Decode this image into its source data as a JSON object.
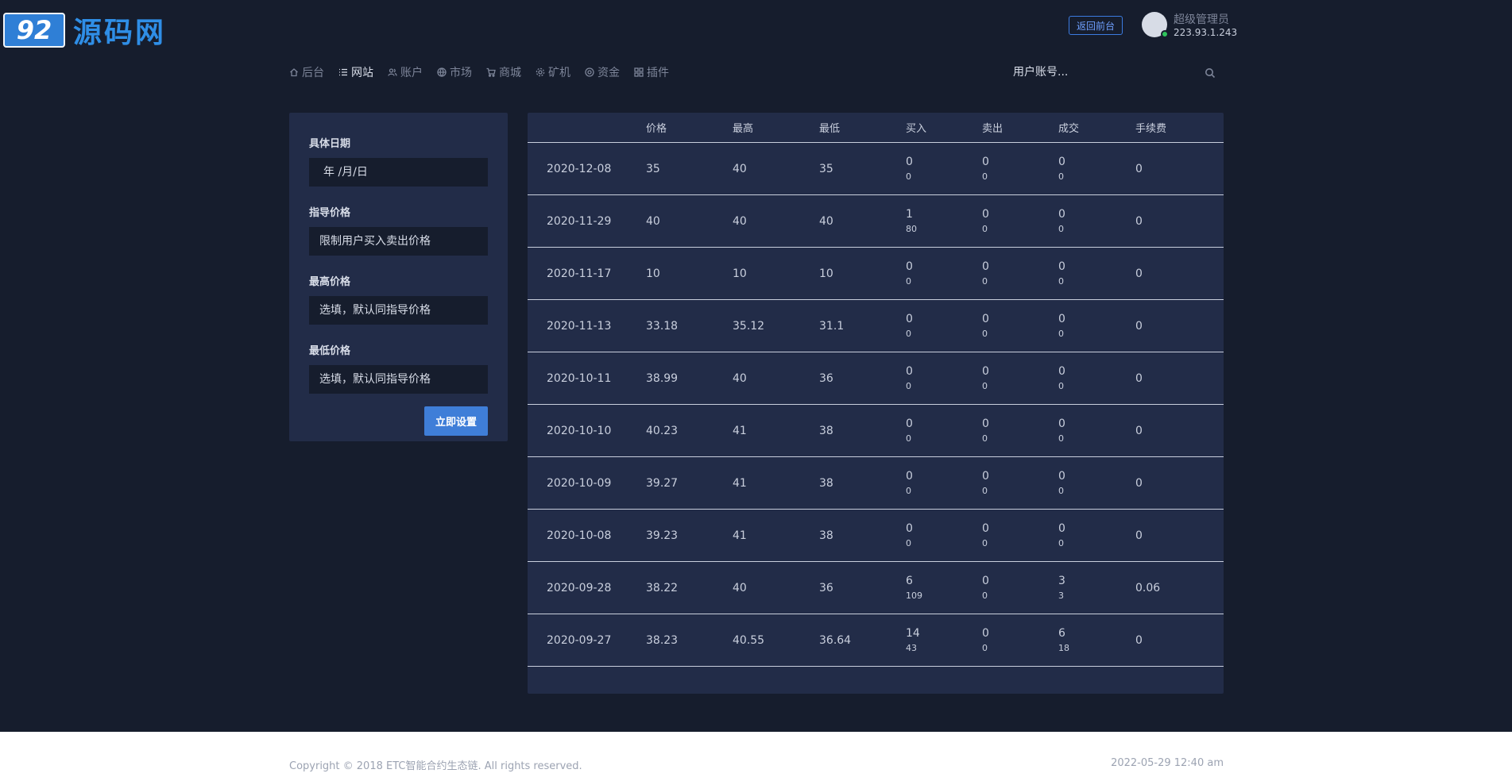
{
  "logo": {
    "mark": "92",
    "text": "源码网"
  },
  "header": {
    "front_button": "返回前台",
    "user_name": "超级管理员",
    "user_ip": "223.93.1.243"
  },
  "nav": {
    "items": [
      {
        "label": "后台",
        "icon": "home-icon"
      },
      {
        "label": "网站",
        "icon": "list-icon"
      },
      {
        "label": "账户",
        "icon": "users-icon"
      },
      {
        "label": "市场",
        "icon": "globe-icon"
      },
      {
        "label": "商城",
        "icon": "cart-icon"
      },
      {
        "label": "矿机",
        "icon": "gear-icon"
      },
      {
        "label": "资金",
        "icon": "coin-icon"
      },
      {
        "label": "插件",
        "icon": "grid-icon"
      }
    ],
    "active": "网站"
  },
  "search": {
    "placeholder": "用户账号..."
  },
  "form": {
    "date_label": "具体日期",
    "date_placeholder": "年 /月/日",
    "guide_label": "指导价格",
    "guide_placeholder": "限制用户买入卖出价格",
    "high_label": "最高价格",
    "high_placeholder": "选填，默认同指导价格",
    "low_label": "最低价格",
    "low_placeholder": "选填，默认同指导价格",
    "submit": "立即设置"
  },
  "table": {
    "headers": [
      "",
      "价格",
      "最高",
      "最低",
      "买入",
      "卖出",
      "成交",
      "手续费"
    ],
    "rows": [
      {
        "date": "2020-12-08",
        "price": "35",
        "high": "40",
        "low": "35",
        "buy": "0",
        "buy_sub": "0",
        "sell": "0",
        "sell_sub": "0",
        "deal": "0",
        "deal_sub": "0",
        "fee": "0"
      },
      {
        "date": "2020-11-29",
        "price": "40",
        "high": "40",
        "low": "40",
        "buy": "1",
        "buy_sub": "80",
        "sell": "0",
        "sell_sub": "0",
        "deal": "0",
        "deal_sub": "0",
        "fee": "0"
      },
      {
        "date": "2020-11-17",
        "price": "10",
        "high": "10",
        "low": "10",
        "buy": "0",
        "buy_sub": "0",
        "sell": "0",
        "sell_sub": "0",
        "deal": "0",
        "deal_sub": "0",
        "fee": "0"
      },
      {
        "date": "2020-11-13",
        "price": "33.18",
        "high": "35.12",
        "low": "31.1",
        "buy": "0",
        "buy_sub": "0",
        "sell": "0",
        "sell_sub": "0",
        "deal": "0",
        "deal_sub": "0",
        "fee": "0"
      },
      {
        "date": "2020-10-11",
        "price": "38.99",
        "high": "40",
        "low": "36",
        "buy": "0",
        "buy_sub": "0",
        "sell": "0",
        "sell_sub": "0",
        "deal": "0",
        "deal_sub": "0",
        "fee": "0"
      },
      {
        "date": "2020-10-10",
        "price": "40.23",
        "high": "41",
        "low": "38",
        "buy": "0",
        "buy_sub": "0",
        "sell": "0",
        "sell_sub": "0",
        "deal": "0",
        "deal_sub": "0",
        "fee": "0"
      },
      {
        "date": "2020-10-09",
        "price": "39.27",
        "high": "41",
        "low": "38",
        "buy": "0",
        "buy_sub": "0",
        "sell": "0",
        "sell_sub": "0",
        "deal": "0",
        "deal_sub": "0",
        "fee": "0"
      },
      {
        "date": "2020-10-08",
        "price": "39.23",
        "high": "41",
        "low": "38",
        "buy": "0",
        "buy_sub": "0",
        "sell": "0",
        "sell_sub": "0",
        "deal": "0",
        "deal_sub": "0",
        "fee": "0"
      },
      {
        "date": "2020-09-28",
        "price": "38.22",
        "high": "40",
        "low": "36",
        "buy": "6",
        "buy_sub": "109",
        "sell": "0",
        "sell_sub": "0",
        "deal": "3",
        "deal_sub": "3",
        "fee": "0.06"
      },
      {
        "date": "2020-09-27",
        "price": "38.23",
        "high": "40.55",
        "low": "36.64",
        "buy": "14",
        "buy_sub": "43",
        "sell": "0",
        "sell_sub": "0",
        "deal": "6",
        "deal_sub": "18",
        "fee": "0"
      }
    ]
  },
  "footer": {
    "copyright": "Copyright © 2018 ETC智能合约生态链. All rights reserved.",
    "timestamp": "2022-05-29 12:40 am"
  },
  "colors": {
    "background": "#161d2d",
    "panel": "#222c48",
    "accent": "#3f7ed8",
    "online": "#2fc45c"
  }
}
